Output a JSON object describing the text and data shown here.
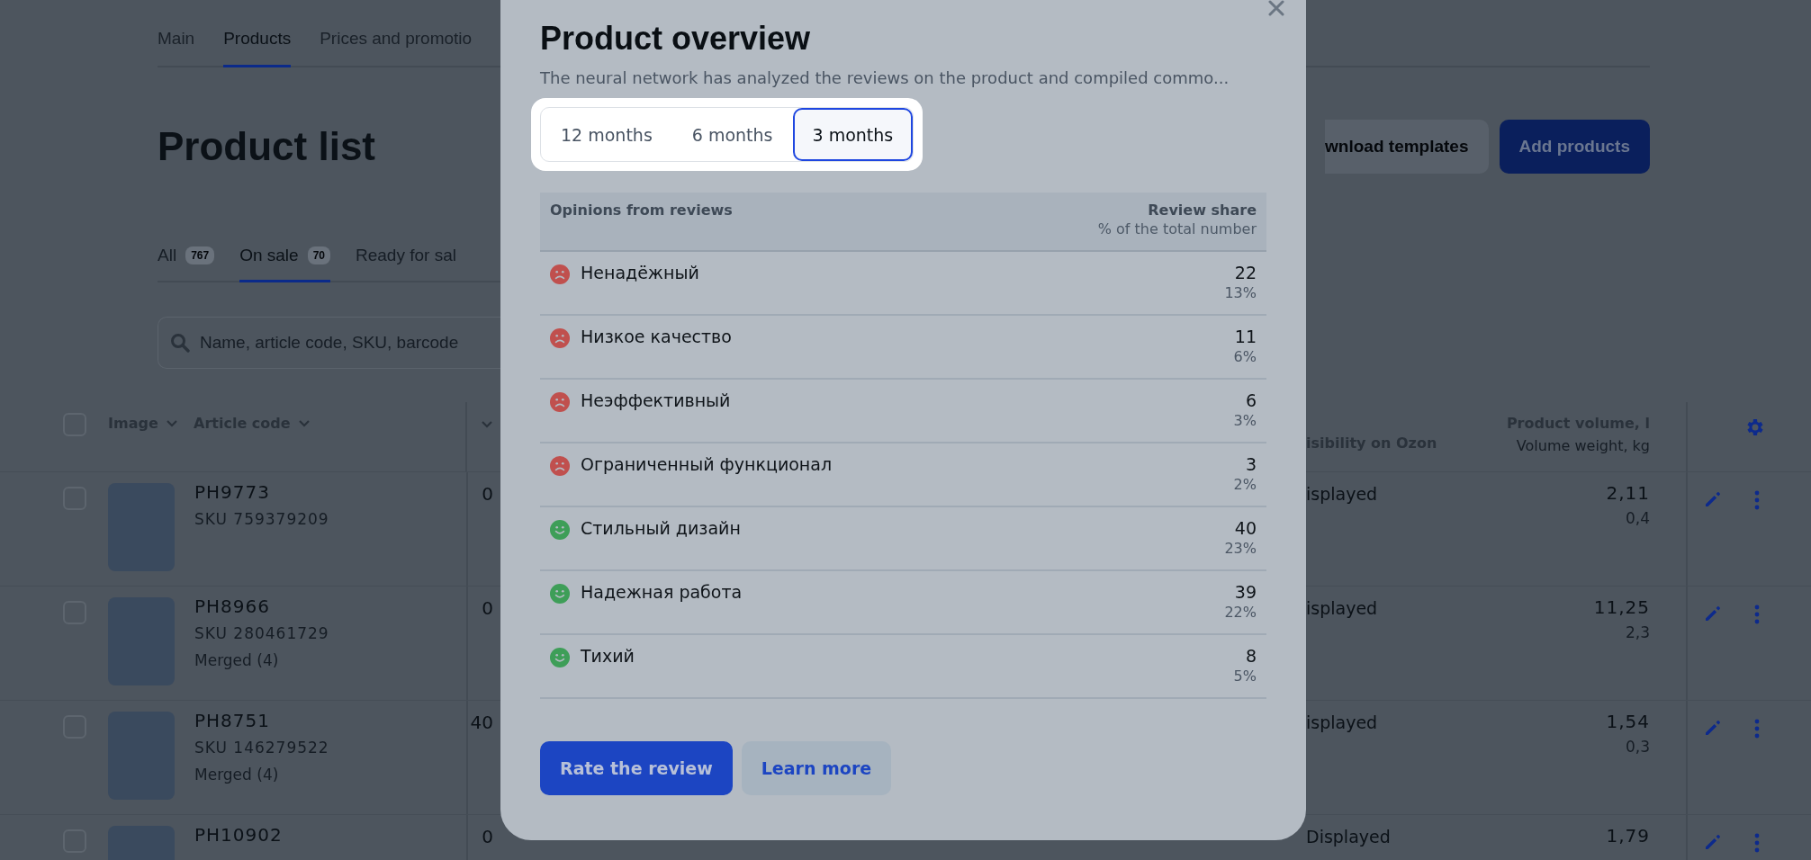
{
  "nav": {
    "items": [
      {
        "label": "Main",
        "selected": false
      },
      {
        "label": "Products",
        "selected": true
      },
      {
        "label": "Prices and promotio",
        "selected": false
      }
    ]
  },
  "page_title": "Product list",
  "header_buttons": [
    {
      "label": "wnload templates",
      "kind": "secondary"
    },
    {
      "label": "Add products",
      "kind": "primary"
    }
  ],
  "status_tabs": [
    {
      "label": "All",
      "count": "767",
      "selected": false
    },
    {
      "label": "On sale",
      "count": "70",
      "selected": true
    },
    {
      "label": "Ready for sal",
      "selected": false
    }
  ],
  "search": {
    "placeholder": "Name, article code, SKU, barcode"
  },
  "table": {
    "select_all": {
      "checked": false
    },
    "columns": [
      {
        "label": "Image"
      },
      {
        "label": "Article code"
      },
      {
        "label": "isibility on Ozon"
      },
      {
        "label": "Product volume, l",
        "sublabel": "Volume weight, kg"
      }
    ],
    "rows": [
      {
        "checked": false,
        "article": "PH9773",
        "sku": "SKU 759379209",
        "column_3": "0",
        "visibility": "isplayed",
        "volume": "2,11",
        "weight": "0,4"
      },
      {
        "checked": false,
        "article": "PH8966",
        "sku": "SKU 280461729",
        "merged": "Merged (4)",
        "column_3": "0",
        "visibility": "isplayed",
        "volume": "11,25",
        "weight": "2,3"
      },
      {
        "checked": false,
        "article": "PH8751",
        "sku": "SKU 146279522",
        "merged": "Merged (4)",
        "column_3": "40",
        "visibility": "isplayed",
        "volume": "1,54",
        "weight": "0,3"
      },
      {
        "checked": false,
        "article": "PH10902",
        "column_3": "0",
        "visibility": "Displayed",
        "volume": "1,79"
      }
    ]
  },
  "modal": {
    "title": "Product overview",
    "description": "The neural network has analyzed the reviews on the product and compiled commo...",
    "periods": [
      {
        "label": "12 months",
        "selected": false
      },
      {
        "label": "6 months",
        "selected": false
      },
      {
        "label": "3 months",
        "selected": true
      }
    ],
    "table": {
      "columns": [
        {
          "label": "Opinions from reviews"
        },
        {
          "label": "Review share",
          "sublabel": "% of the total number"
        }
      ],
      "rows": [
        {
          "kind": "negative",
          "opinion": "Ненадёжный",
          "count": "22",
          "share": "13%"
        },
        {
          "kind": "negative",
          "opinion": "Низкое качество",
          "count": "11",
          "share": "6%"
        },
        {
          "kind": "negative",
          "opinion": "Неэффективный",
          "count": "6",
          "share": "3%"
        },
        {
          "kind": "negative",
          "opinion": "Ограниченный функционал",
          "count": "3",
          "share": "2%"
        },
        {
          "kind": "positive",
          "opinion": "Стильный дизайн",
          "count": "40",
          "share": "23%"
        },
        {
          "kind": "positive",
          "opinion": "Надежная работа",
          "count": "39",
          "share": "22%"
        },
        {
          "kind": "positive",
          "opinion": "Тихий",
          "count": "8",
          "share": "5%"
        }
      ]
    },
    "buttons": [
      {
        "label": "Rate the review",
        "kind": "primary"
      },
      {
        "label": "Learn more",
        "kind": "secondary"
      }
    ]
  }
}
